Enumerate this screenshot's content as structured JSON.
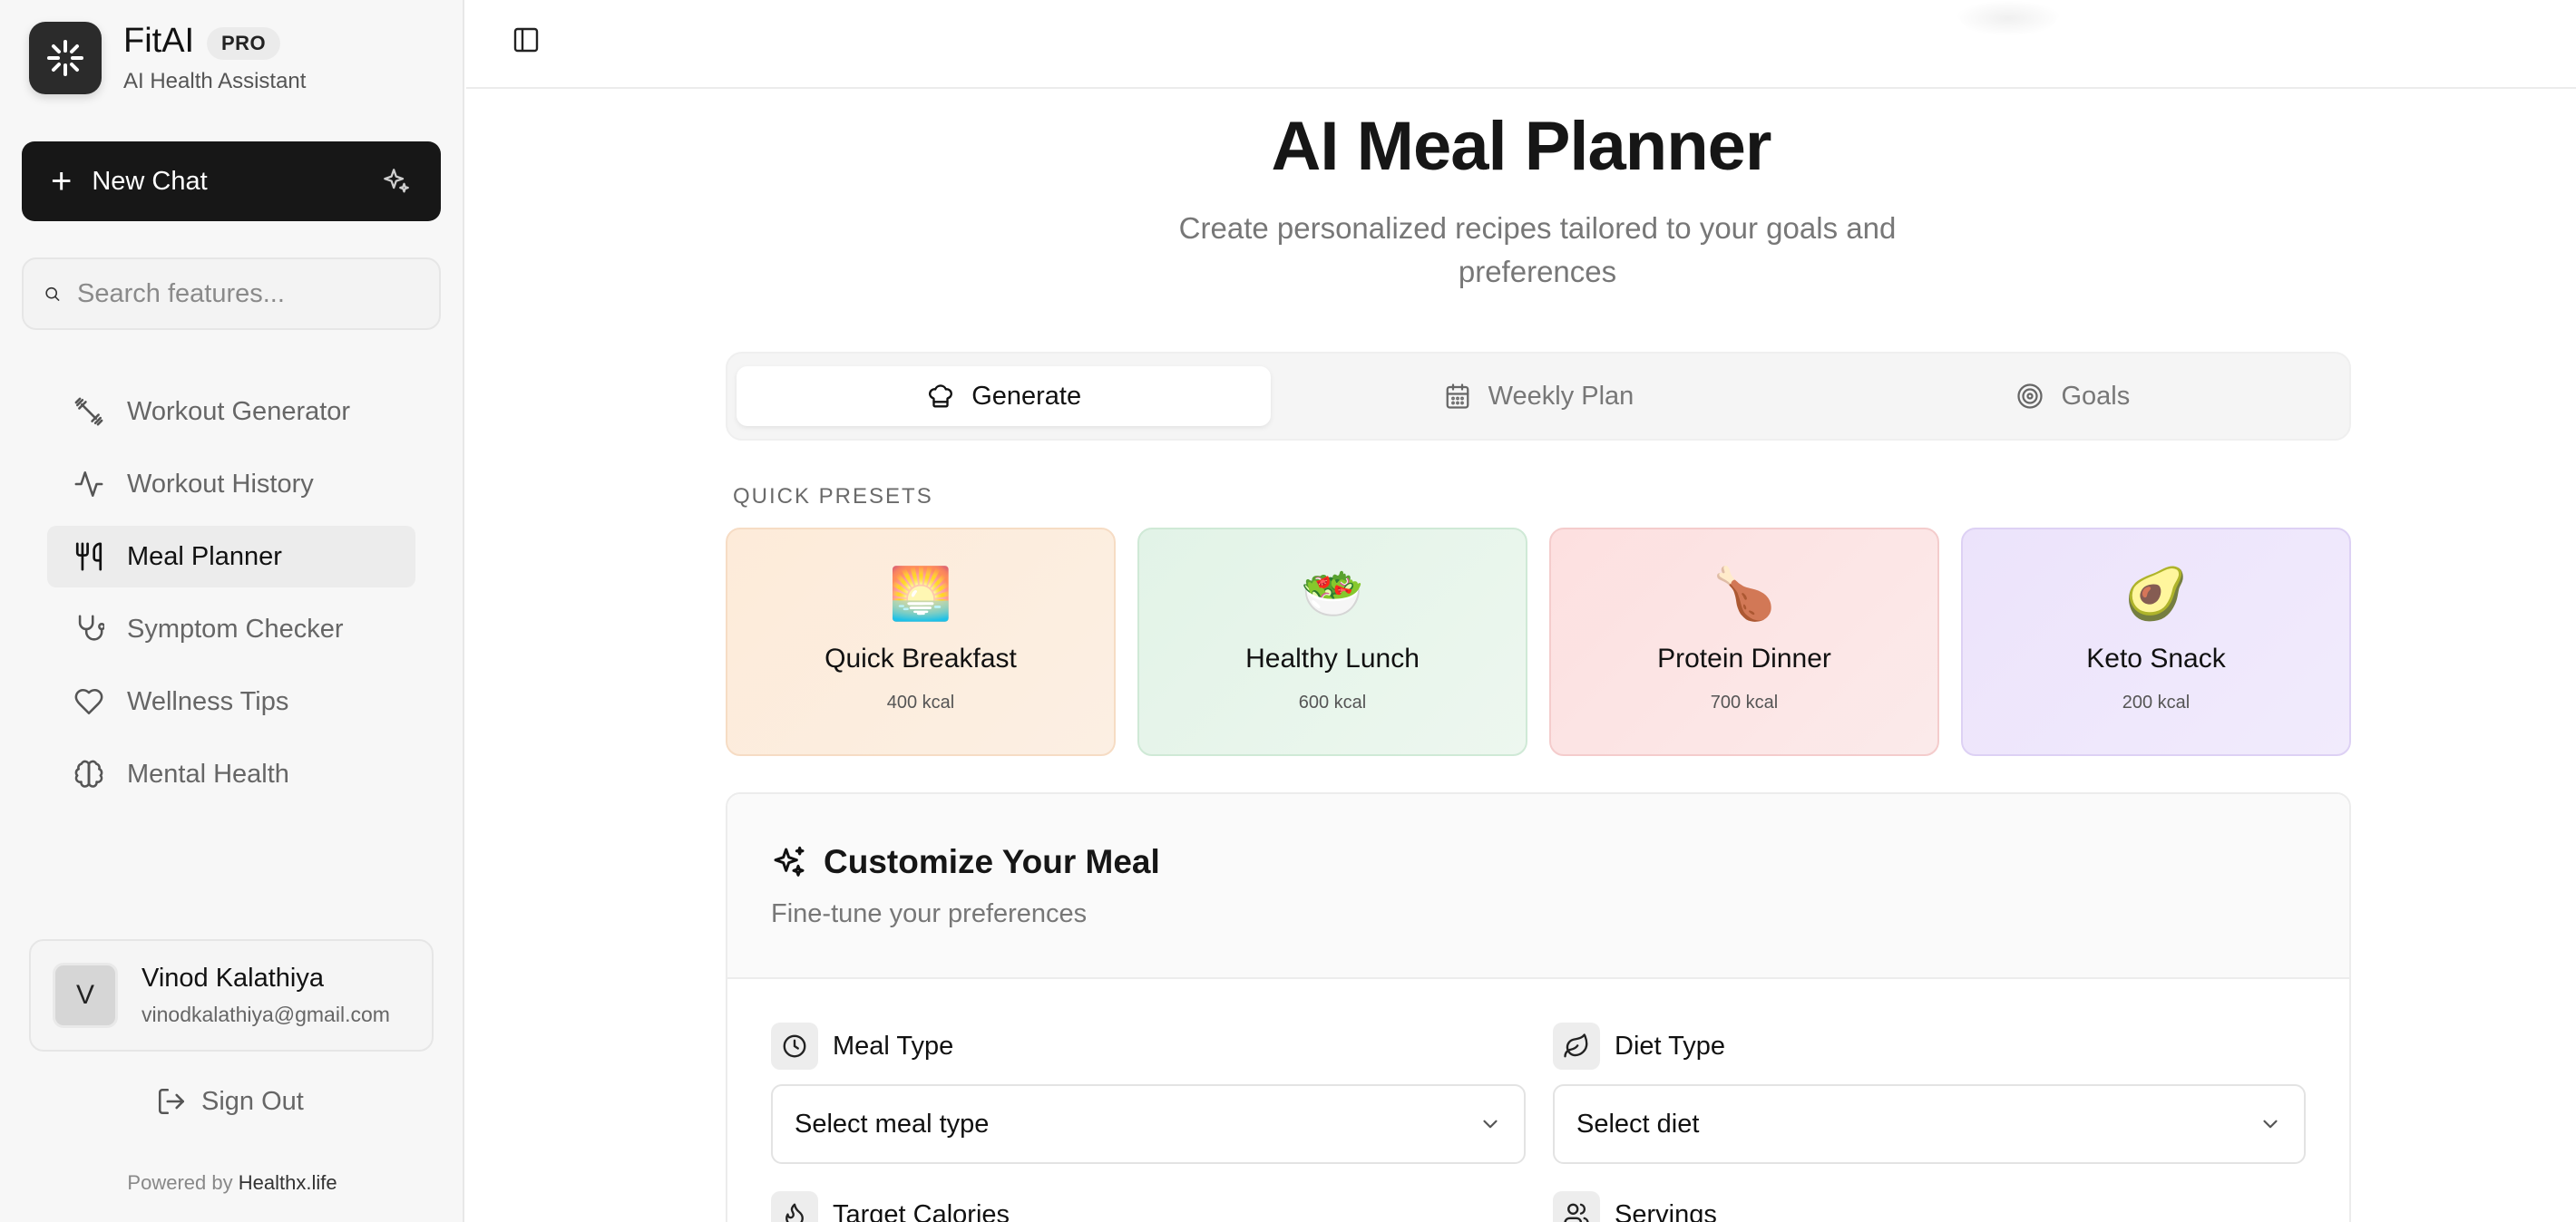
{
  "sidebar": {
    "brand": "FitAI",
    "badge": "PRO",
    "subtitle": "AI Health Assistant",
    "new_chat": "New Chat",
    "search_placeholder": "Search features...",
    "nav": [
      {
        "label": "Workout Generator",
        "icon": "dumbbell-icon",
        "active": false
      },
      {
        "label": "Workout History",
        "icon": "activity-icon",
        "active": false
      },
      {
        "label": "Meal Planner",
        "icon": "utensils-icon",
        "active": true
      },
      {
        "label": "Symptom Checker",
        "icon": "stethoscope-icon",
        "active": false
      },
      {
        "label": "Wellness Tips",
        "icon": "heart-icon",
        "active": false
      },
      {
        "label": "Mental Health",
        "icon": "brain-icon",
        "active": false
      }
    ],
    "user": {
      "initial": "V",
      "name": "Vinod Kalathiya",
      "email": "vinodkalathiya@gmail.com"
    },
    "sign_out": "Sign Out",
    "powered_by": "Powered by",
    "powered_brand": "Healthx.life"
  },
  "main": {
    "title": "AI Meal Planner",
    "subtitle": "Create personalized recipes tailored to your goals and preferences",
    "tabs": [
      {
        "label": "Generate",
        "icon": "chef-hat-icon",
        "active": true
      },
      {
        "label": "Weekly Plan",
        "icon": "calendar-icon",
        "active": false
      },
      {
        "label": "Goals",
        "icon": "target-icon",
        "active": false
      }
    ],
    "presets_label": "QUICK PRESETS",
    "presets": [
      {
        "emoji": "🌅",
        "name": "Quick Breakfast",
        "kcal": "400 kcal"
      },
      {
        "emoji": "🥗",
        "name": "Healthy Lunch",
        "kcal": "600 kcal"
      },
      {
        "emoji": "🍗",
        "name": "Protein Dinner",
        "kcal": "700 kcal"
      },
      {
        "emoji": "🥑",
        "name": "Keto Snack",
        "kcal": "200 kcal"
      }
    ],
    "customize": {
      "title": "Customize Your Meal",
      "subtitle": "Fine-tune your preferences",
      "meal_type_label": "Meal Type",
      "meal_type_value": "Select meal type",
      "diet_type_label": "Diet Type",
      "diet_type_value": "Select diet",
      "target_calories_label": "Target Calories",
      "servings_label": "Servings"
    }
  },
  "colors": {
    "accent_dark": "#171717",
    "preset_breakfast": "#fdebd9",
    "preset_lunch": "#e2f3e7",
    "preset_dinner": "#fde0e0",
    "preset_snack": "#ece3fb"
  }
}
